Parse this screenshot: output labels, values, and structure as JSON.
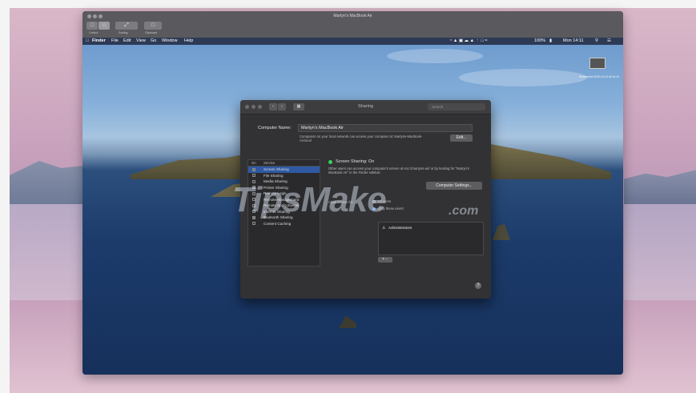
{
  "viewer": {
    "title": "Martyn's MacBook Air",
    "toolbar": [
      {
        "icon": "home-icon",
        "label": "Control"
      },
      {
        "icon": "scale-icon",
        "label": "Scaling"
      },
      {
        "icon": "clipboard-icon",
        "label": "Clipboard"
      }
    ]
  },
  "menubar": {
    "apple": "",
    "items": [
      "Finder",
      "File",
      "Edit",
      "View",
      "Go",
      "Window",
      "Help"
    ],
    "battery": "100%",
    "clock": "Mon 14:11"
  },
  "desktop": {
    "icon_label": "Screenshot 2020-10-19 at 14.11"
  },
  "prefs": {
    "title": "Sharing",
    "search_placeholder": "Search",
    "computer_name_label": "Computer Name:",
    "computer_name_value": "Martyn's MacBook Air",
    "computer_name_desc": "Computers on your local network can access your computer at: Martyns-MacBook-Air.local",
    "edit_label": "Edit...",
    "list_header_on": "On",
    "list_header_service": "Service",
    "services": [
      {
        "name": "Screen Sharing",
        "on": true,
        "selected": true
      },
      {
        "name": "File Sharing",
        "on": false,
        "selected": false
      },
      {
        "name": "Media Sharing",
        "on": false,
        "selected": false
      },
      {
        "name": "Printer Sharing",
        "on": true,
        "selected": false
      },
      {
        "name": "Remote Login",
        "on": false,
        "selected": false
      },
      {
        "name": "Remote Management",
        "on": false,
        "selected": false
      },
      {
        "name": "Remote Apple Events",
        "on": false,
        "selected": false
      },
      {
        "name": "Internet Sharing",
        "on": false,
        "selected": false
      },
      {
        "name": "Bluetooth Sharing",
        "on": true,
        "selected": false
      },
      {
        "name": "Content Caching",
        "on": false,
        "selected": false
      }
    ],
    "status": "Screen Sharing: On",
    "status_desc": "Other users can access your computer's screen at vnc://martyns-air/ or by looking for \"Martyn's MacBook Air\" in the Finder sidebar.",
    "computer_settings_label": "Computer Settings...",
    "allow_access_label": "Allow access for:",
    "access_options": [
      "All users",
      "Only these users:"
    ],
    "users": [
      "Administrators"
    ],
    "add_remove": "+ −",
    "help": "?"
  },
  "watermark": {
    "text": "TipsMake",
    "suffix": ".com"
  }
}
